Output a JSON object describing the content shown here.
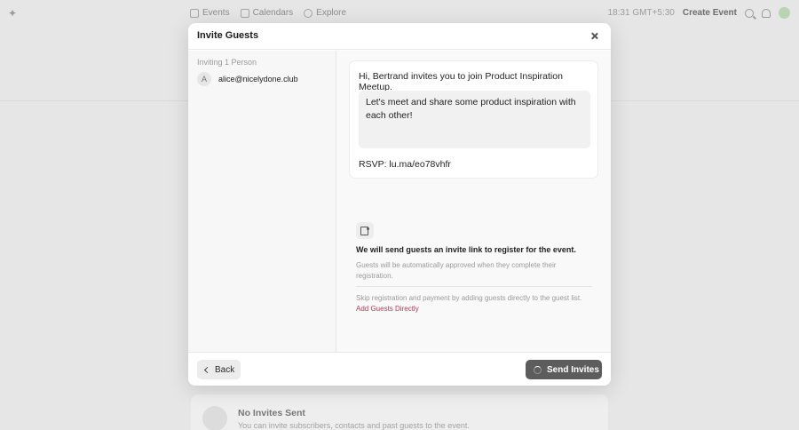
{
  "topbar": {
    "nav": [
      {
        "label": "Events",
        "icon": "events-icon"
      },
      {
        "label": "Calendars",
        "icon": "calendar-icon"
      },
      {
        "label": "Explore",
        "icon": "compass-icon"
      }
    ],
    "time": "18:31 GMT+5:30",
    "create_event": "Create Event"
  },
  "background": {
    "card_title": "No Invites Sent",
    "card_subtitle": "You can invite subscribers, contacts and past guests to the event."
  },
  "modal": {
    "title": "Invite Guests",
    "inviting_label": "Inviting 1 Person",
    "guests": [
      {
        "initial": "A",
        "email": "alice@nicelydone.club"
      }
    ],
    "message": {
      "greeting": "Hi, Bertrand invites you to join Product Inspiration Meetup.",
      "body": "Let's meet and share some product inspiration with each other!",
      "rsvp": "RSVP: lu.ma/eo78vhfr"
    },
    "info": {
      "title": "We will send guests an invite link to register for the event.",
      "description": "Guests will be automatically approved when they complete their registration.",
      "skip_text": "Skip registration and payment by adding guests directly to the guest list.",
      "add_directly_link": "Add Guests Directly"
    },
    "footer": {
      "back_label": "Back",
      "send_label": "Send Invites"
    }
  },
  "colors": {
    "link_accent": "#c0365a",
    "send_button": "#5d5d5d"
  }
}
